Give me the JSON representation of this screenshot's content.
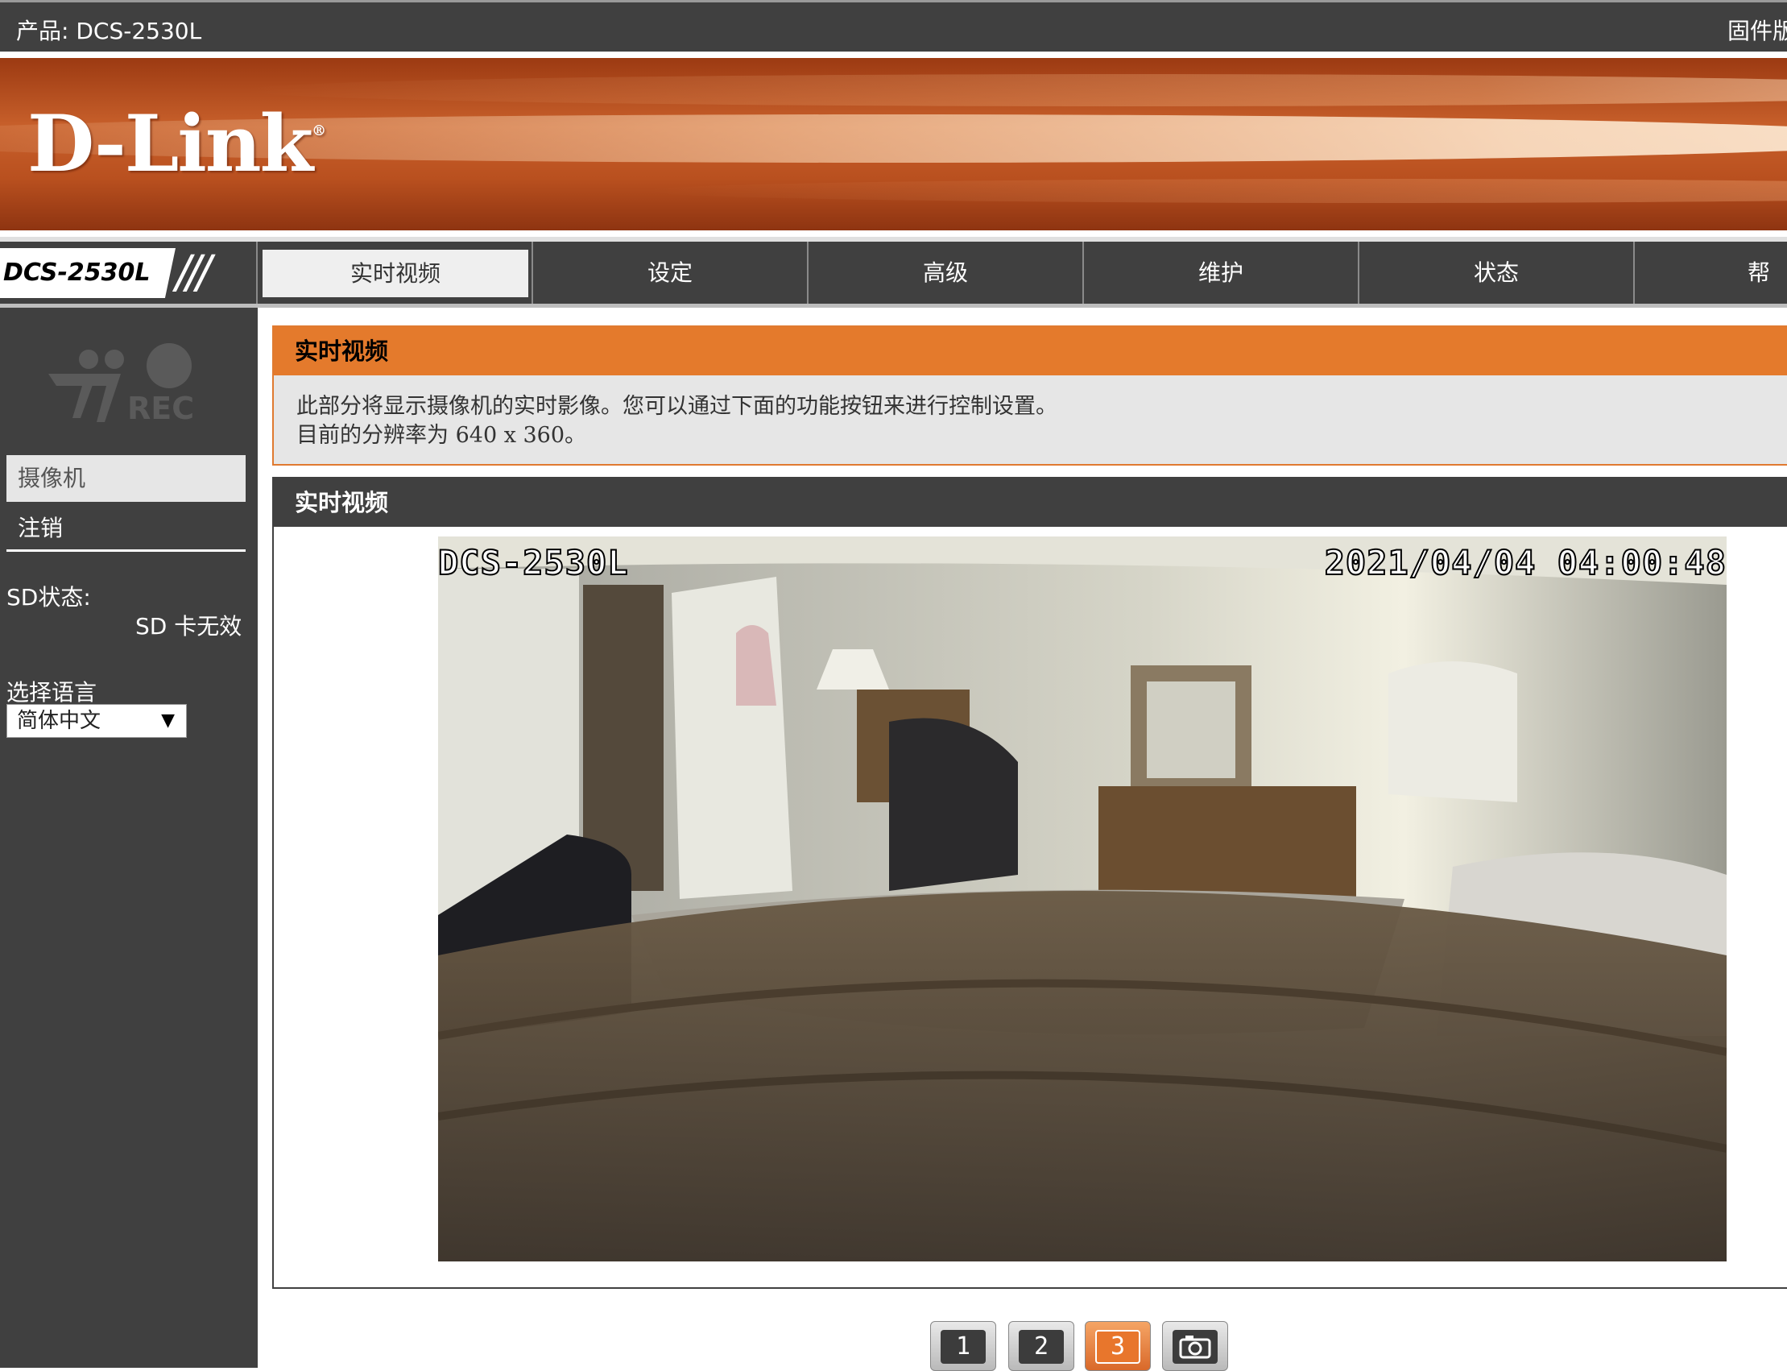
{
  "topbar": {
    "product": "产品: DCS-2530L",
    "firmware": "固件版"
  },
  "brand": {
    "logo": "D-Link",
    "reg": "®"
  },
  "nav": {
    "model": "DCS-2530L",
    "slashes": "///",
    "tabs": [
      {
        "label": "实时视频",
        "active": true
      },
      {
        "label": "设定",
        "active": false
      },
      {
        "label": "高级",
        "active": false
      },
      {
        "label": "维护",
        "active": false
      },
      {
        "label": "状态",
        "active": false
      },
      {
        "label": "帮助",
        "active": false
      }
    ]
  },
  "sidebar": {
    "rec_text": "REC",
    "menu": [
      {
        "label": "摄像机"
      },
      {
        "label": "注销"
      }
    ],
    "sd_label": "SD状态:",
    "sd_value": "SD 卡无效",
    "lang_label": "选择语言",
    "lang_selected": "简体中文"
  },
  "info": {
    "title": "实时视频",
    "line1": "此部分将显示摄像机的实时影像。您可以通过下面的功能按钮来进行控制设置。",
    "line2": "目前的分辨率为 640 x 360。"
  },
  "video": {
    "title": "实时视频",
    "osd_name": "DCS-2530L",
    "osd_time": "2021/04/04 04:00:48"
  },
  "controls": [
    {
      "label": "1",
      "icon": "profile-1-icon"
    },
    {
      "label": "2",
      "icon": "profile-2-icon"
    },
    {
      "label": "3",
      "icon": "profile-3-icon",
      "active": true
    },
    {
      "label": "",
      "icon": "snapshot-camera-icon"
    }
  ],
  "colors": {
    "accent": "#e47a2c",
    "dark": "#404040",
    "banner": "#c8602b"
  }
}
